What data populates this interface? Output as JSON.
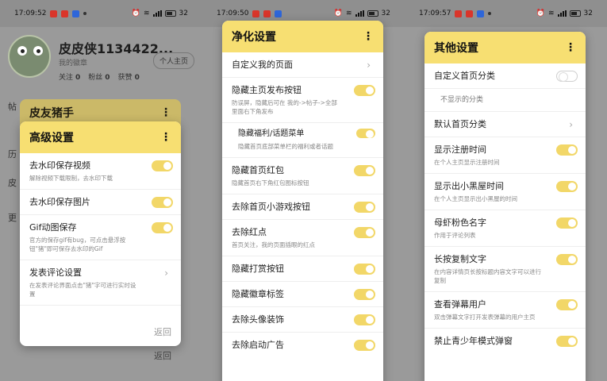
{
  "screens": [
    {
      "status": {
        "time": "17:09:52",
        "battery": "32"
      },
      "profile": {
        "name": "皮皮侠1134422...",
        "badge": "我的徽章",
        "stats": [
          {
            "label": "关注",
            "value": "0"
          },
          {
            "label": "粉丝",
            "value": "0"
          },
          {
            "label": "获赞",
            "value": "0"
          }
        ],
        "home_button": "个人主页"
      },
      "bg_rows": [
        "帖",
        "历",
        "皮",
        "更",
        "返回"
      ],
      "back_dialog": {
        "title": "皮友猪手"
      },
      "dialog": {
        "title": "高级设置",
        "items": [
          {
            "label": "去水印保存视频",
            "desc": "解除视频下载限制，去水印下载",
            "control": "toggle",
            "on": true
          },
          {
            "label": "去水印保存图片",
            "desc": "",
            "control": "toggle",
            "on": true
          },
          {
            "label": "Gif动图保存",
            "desc": "官方的保存gif有bug，可点击悬浮按钮\"猪\"即可保存去水印的Gif",
            "control": "toggle",
            "on": true
          },
          {
            "label": "发表评论设置",
            "desc": "在发表评论界面点击\"猪\"字可进行实时设置",
            "control": "chevron"
          }
        ],
        "back": "返回"
      }
    },
    {
      "status": {
        "time": "17:09:50",
        "battery": "32"
      },
      "dialog": {
        "title": "净化设置",
        "items": [
          {
            "label": "自定义我的页面",
            "desc": "",
            "control": "chevron"
          },
          {
            "label": "隐藏主页发布按钮",
            "desc": "防误屏，隐藏后可在 我的->帖子->全部 里面右下角发布",
            "control": "toggle",
            "on": true
          },
          {
            "label": "隐藏福利/话题菜单",
            "desc": "隐藏首页底部菜单栏的福利或者话题",
            "control": "toggle",
            "on": true,
            "sub": true
          },
          {
            "label": "隐藏首页红包",
            "desc": "隐藏首页右下角红包图标按钮",
            "control": "toggle",
            "on": true
          },
          {
            "label": "去除首页小游戏按钮",
            "desc": "",
            "control": "toggle",
            "on": true
          },
          {
            "label": "去除红点",
            "desc": "首页关注，我的页面插眼的红点",
            "control": "toggle",
            "on": true
          },
          {
            "label": "隐藏打赏按钮",
            "desc": "",
            "control": "toggle",
            "on": true
          },
          {
            "label": "隐藏徽章标签",
            "desc": "",
            "control": "toggle",
            "on": true
          },
          {
            "label": "去除头像装饰",
            "desc": "",
            "control": "toggle",
            "on": true
          },
          {
            "label": "去除启动广告",
            "desc": "",
            "control": "toggle",
            "on": true
          }
        ]
      }
    },
    {
      "status": {
        "time": "17:09:57",
        "battery": "32"
      },
      "dialog": {
        "title": "其他设置",
        "items": [
          {
            "label": "自定义首页分类",
            "desc": "",
            "control": "toggle",
            "on": false
          },
          {
            "label": "不显示的分类",
            "desc": "",
            "control": "none",
            "sub": true
          },
          {
            "label": "默认首页分类",
            "desc": "",
            "control": "chevron"
          },
          {
            "label": "显示注册时间",
            "desc": "在个人主页显示注册时间",
            "control": "toggle",
            "on": true
          },
          {
            "label": "显示出小黑屋时间",
            "desc": "在个人主页显示出小黑屋的时间",
            "control": "toggle",
            "on": true
          },
          {
            "label": "母虾粉色名字",
            "desc": "作用于评论列表",
            "control": "toggle",
            "on": true
          },
          {
            "label": "长按复制文字",
            "desc": "在内容详情页长按标题内容文字可以进行复制",
            "control": "toggle",
            "on": true
          },
          {
            "label": "查看弹幕用户",
            "desc": "双击弹幕文字打开发表弹幕的用户主页",
            "control": "toggle",
            "on": true
          },
          {
            "label": "禁止青少年模式弹窗",
            "desc": "",
            "control": "toggle",
            "on": true
          }
        ]
      }
    }
  ]
}
